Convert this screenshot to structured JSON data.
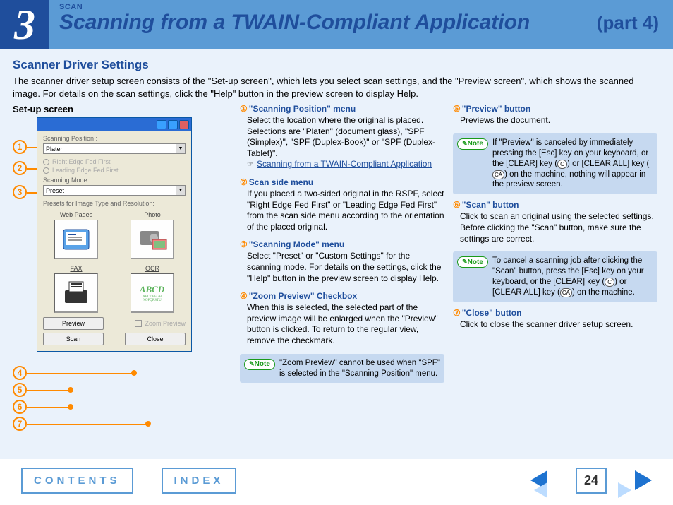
{
  "header": {
    "chapter": "3",
    "eyebrow": "SCAN",
    "title": "Scanning from a TWAIN-Compliant Application",
    "part": "(part 4)"
  },
  "section_title": "Scanner Driver Settings",
  "intro": "The scanner driver setup screen consists of the \"Set-up screen\", which lets you select scan settings, and the \"Preview screen\", which shows the scanned image. For details on the scan settings, click the \"Help\" button in the preview screen to display Help.",
  "left": {
    "subhead": "Set-up screen",
    "scanpos_label": "Scanning Position :",
    "scanpos_value": "Platen",
    "radio1": "Right Edge Fed First",
    "radio2": "Leading Edge Fed First",
    "scanmode_label": "Scanning Mode :",
    "scanmode_value": "Preset",
    "presets_label": "Presets for Image Type and Resolution:",
    "thumbs": [
      "Web Pages",
      "Photo",
      "FAX",
      "OCR"
    ],
    "ocr_sample": "ABCD",
    "ocr_sample2": "ABCDEFGH\nNOPQRSTU",
    "btn_preview": "Preview",
    "chk_zoom": "Zoom Preview",
    "btn_scan": "Scan",
    "btn_close": "Close"
  },
  "items": [
    {
      "n": "①",
      "title": "\"Scanning Position\" menu",
      "body": "Select the location where the original is placed. Selections are \"Platen\" (document glass), \"SPF (Simplex)\", \"SPF (Duplex-Book)\" or \"SPF (Duplex-Tablet)\".",
      "link": "Scanning from a TWAIN-Compliant Application"
    },
    {
      "n": "②",
      "title": "Scan side menu",
      "body": "If you placed a two-sided original in the RSPF, select \"Right Edge Fed First\" or \"Leading Edge Fed First\" from the scan side menu according to the orientation of the placed original."
    },
    {
      "n": "③",
      "title": "\"Scanning Mode\" menu",
      "body": "Select \"Preset\" or \"Custom Settings\" for the scanning mode. For details on the settings, click the \"Help\" button in the preview screen to display Help."
    },
    {
      "n": "④",
      "title": "\"Zoom Preview\" Checkbox",
      "body": "When this is selected, the selected part of the preview image will be enlarged when the \"Preview\" button is clicked. To return to the regular view, remove the checkmark."
    },
    {
      "n": "⑤",
      "title": "\"Preview\" button",
      "body": "Previews the document."
    },
    {
      "n": "⑥",
      "title": "\"Scan\" button",
      "body": "Click to scan an original using the selected settings. Before clicking the \"Scan\" button, make sure the settings are correct."
    },
    {
      "n": "⑦",
      "title": "\"Close\" button",
      "body": "Click to close the scanner driver setup screen."
    }
  ],
  "notes": {
    "zoom": "\"Zoom Preview\" cannot be used when \"SPF\" is selected in the \"Scanning Position\" menu.",
    "preview_a": "If \"Preview\" is canceled by immediately pressing the [Esc] key on your keyboard, or the [CLEAR] key (",
    "preview_b": ") or [CLEAR ALL] key (",
    "preview_c": ") on the machine, nothing will appear in the preview screen.",
    "scan_a": "To cancel a scanning job after clicking the \"Scan\" button, press the [Esc] key on your keyboard, or the [CLEAR] key (",
    "scan_b": ") or [CLEAR ALL] key (",
    "scan_c": ") on the machine.",
    "key_c": "C",
    "key_ca": "CA",
    "note_label": "Note"
  },
  "bullets": [
    "1",
    "2",
    "3",
    "4",
    "5",
    "6",
    "7"
  ],
  "footer": {
    "contents": "CONTENTS",
    "index": "INDEX",
    "page": "24"
  }
}
